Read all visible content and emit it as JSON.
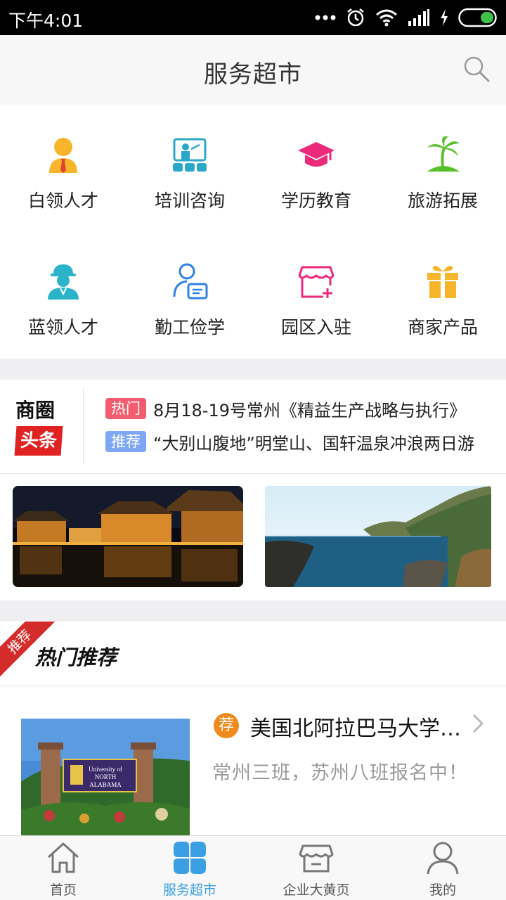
{
  "status_bar": {
    "time": "下午4:01"
  },
  "header": {
    "title": "服务超市"
  },
  "services": [
    {
      "label": "白领人才",
      "icon": "white-collar-icon"
    },
    {
      "label": "培训咨询",
      "icon": "training-icon"
    },
    {
      "label": "学历教育",
      "icon": "graduation-cap-icon"
    },
    {
      "label": "旅游拓展",
      "icon": "palm-tree-icon"
    },
    {
      "label": "蓝领人才",
      "icon": "blue-collar-worker-icon"
    },
    {
      "label": "勤工俭学",
      "icon": "work-study-icon"
    },
    {
      "label": "园区入驻",
      "icon": "park-store-icon"
    },
    {
      "label": "商家产品",
      "icon": "gift-box-icon"
    }
  ],
  "news": {
    "logo_line1": "商圈",
    "logo_line2": "头条",
    "items": [
      {
        "tag": "热门",
        "text": "8月18-19号常州《精益生产战略与执行》"
      },
      {
        "tag": "推荐",
        "text": "“大别山腹地”明堂山、国轩温泉冲浪两日游"
      }
    ]
  },
  "hot": {
    "ribbon": "推荐",
    "title": "热门推荐",
    "item": {
      "badge": "荐",
      "name": "美国北阿拉巴马大学MBA",
      "subtitle": "常州三班，苏州八班报名中！",
      "sign_line1": "University of",
      "sign_line2": "NORTH",
      "sign_line3": "ALABAMA"
    }
  },
  "tabbar": [
    {
      "label": "首页",
      "icon": "home-icon"
    },
    {
      "label": "服务超市",
      "icon": "service-market-icon"
    },
    {
      "label": "企业大黄页",
      "icon": "store-icon"
    },
    {
      "label": "我的",
      "icon": "person-icon"
    }
  ],
  "colors": {
    "accent": "#3aa0e3",
    "hot_tag": "#f25c6e",
    "recommend_tag": "#7da6f5",
    "badge": "#f08a1d",
    "ribbon": "#d42b2b"
  }
}
